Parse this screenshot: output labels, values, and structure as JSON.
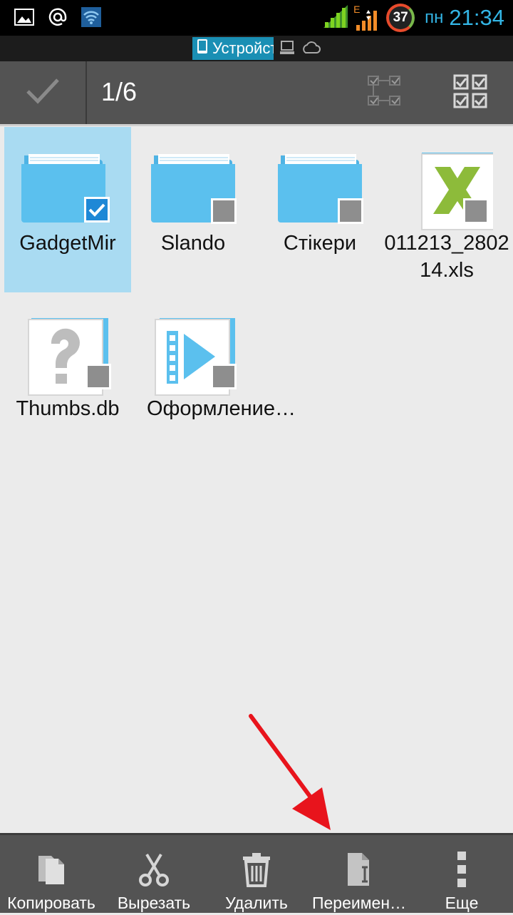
{
  "status_bar": {
    "day": "пн",
    "time": "21:34",
    "battery": "37",
    "network_letter": "E",
    "icons": [
      "gallery-icon",
      "at-icon",
      "wifi-icon",
      "signal-icon",
      "data-signal-icon",
      "battery-icon"
    ]
  },
  "location": {
    "tab_label": "Устройство",
    "icons": [
      "phone-icon",
      "computer-icon",
      "cloud-icon"
    ]
  },
  "action_bar": {
    "selection_count": "1/6",
    "icons": [
      "check-icon",
      "select-range-icon",
      "select-all-icon"
    ]
  },
  "files": [
    {
      "name": "GadgetMir",
      "type": "folder",
      "selected": true
    },
    {
      "name": "Slando",
      "type": "folder",
      "selected": false
    },
    {
      "name": "Стікери",
      "type": "folder",
      "selected": false
    },
    {
      "name": "011213_280214.xls",
      "type": "excel",
      "selected": false
    },
    {
      "name": "Thumbs.db",
      "type": "unknown",
      "selected": false
    },
    {
      "name": "Оформление…",
      "type": "video",
      "selected": false
    }
  ],
  "bottom_bar": {
    "items": [
      {
        "label": "Копировать",
        "icon": "copy-icon"
      },
      {
        "label": "Вырезать",
        "icon": "scissors-icon"
      },
      {
        "label": "Удалить",
        "icon": "trash-icon"
      },
      {
        "label": "Переимен…",
        "icon": "rename-icon"
      },
      {
        "label": "Еще",
        "icon": "more-icon"
      }
    ]
  },
  "colors": {
    "accent": "#33b5e5",
    "folder": "#5bc0ee",
    "selection": "#a9dbf2",
    "bars": "#535353",
    "arrow": "#e8141c"
  }
}
